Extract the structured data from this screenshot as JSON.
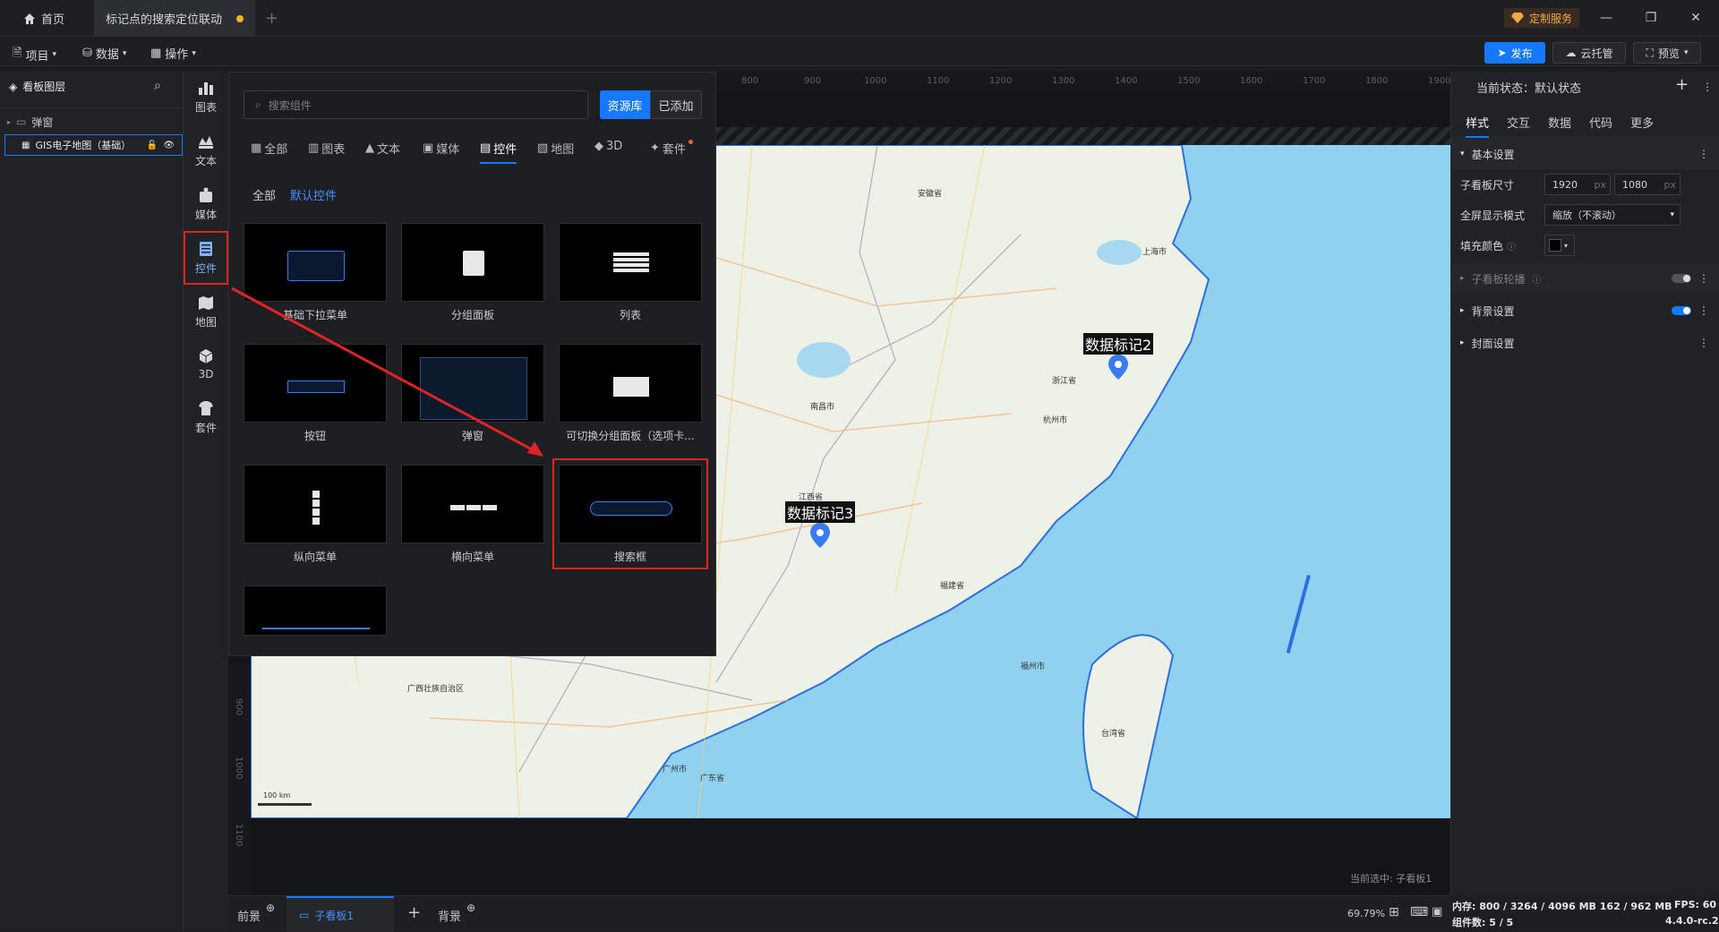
{
  "titlebar": {
    "home_tab": "首页",
    "project_tab": "标记点的搜索定位联动",
    "new_tab": "+",
    "custom_service": "定制服务"
  },
  "menubar": {
    "project": "项目",
    "data": "数据",
    "operate": "操作",
    "publish": "发布",
    "cloud_host": "云托管",
    "preview": "预览"
  },
  "layers_panel": {
    "title": "看板图层",
    "items": [
      {
        "label": "弹窗"
      },
      {
        "label": "GIS电子地图（基础）"
      }
    ]
  },
  "icon_bar": [
    {
      "label": "图表",
      "icon": "bar-chart-icon"
    },
    {
      "label": "文本",
      "icon": "text-icon"
    },
    {
      "label": "媒体",
      "icon": "media-icon"
    },
    {
      "label": "控件",
      "icon": "widget-icon"
    },
    {
      "label": "地图",
      "icon": "map-icon"
    },
    {
      "label": "3D",
      "icon": "cube-icon"
    },
    {
      "label": "套件",
      "icon": "kit-icon"
    }
  ],
  "component_popup": {
    "search_placeholder": "搜索组件",
    "library_btn": "资源库",
    "added_btn": "已添加",
    "categories": [
      "全部",
      "图表",
      "文本",
      "媒体",
      "控件",
      "地图",
      "3D",
      "套件"
    ],
    "sub_filters": [
      "全部",
      "默认控件"
    ],
    "components": [
      "基础下拉菜单",
      "分组面板",
      "列表",
      "按钮",
      "弹窗",
      "可切换分组面板（选项卡...",
      "纵向菜单",
      "横向菜单",
      "搜索框",
      ""
    ]
  },
  "canvas": {
    "ruler_ticks": [
      "800",
      "900",
      "1000",
      "1100",
      "1200",
      "1300",
      "1400",
      "1500",
      "1600",
      "1700",
      "1800",
      "1900"
    ],
    "left_ruler_ticks": [
      "900",
      "1000",
      "1100"
    ],
    "current_selection": "当前选中: 子看板1",
    "scale_label": "100 km"
  },
  "map": {
    "markers": [
      {
        "label": "数据标记2"
      },
      {
        "label": "数据标记3"
      }
    ],
    "place_names": [
      "安徽省",
      "上海市",
      "浙江省",
      "江西省",
      "福建省",
      "台湾省",
      "广东省",
      "广西壮族自治区",
      "南昌市",
      "杭州市",
      "福州市",
      "广州市"
    ]
  },
  "right_panel": {
    "state_label": "当前状态：默认状态",
    "tabs": [
      "样式",
      "交互",
      "数据",
      "代码",
      "更多"
    ],
    "basic_settings": "基本设置",
    "size_label": "子看板尺寸",
    "width": "1920",
    "height": "1080",
    "unit": "px",
    "fullscreen_label": "全屏显示模式",
    "fullscreen_value": "缩放（不滚动）",
    "fill_label": "填充颜色",
    "carousel_label": "子看板轮播",
    "bg_settings": "背景设置",
    "cover_settings": "封面设置"
  },
  "bottom_bar": {
    "foreground": "前景",
    "sub_board": "子看板1",
    "background": "背景",
    "zoom": "69.79%"
  },
  "status": {
    "memory": "内存:  800 / 3264 / 4096 MB  162 / 962 MB",
    "fps": "FPS:  60",
    "components": "组件数: 5 / 5",
    "version": "4.4.0-rc.2"
  },
  "colors": {
    "accent": "#1677ff",
    "highlight_red": "#e02424",
    "marker_blue": "#3a7bf2",
    "sea": "#8fd1ef",
    "land": "#eef1e6"
  }
}
